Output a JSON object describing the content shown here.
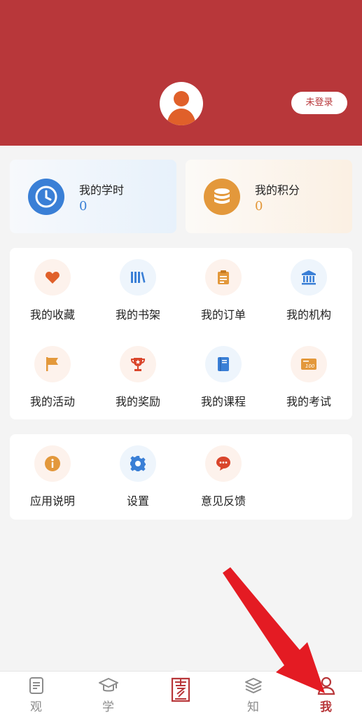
{
  "header": {
    "login_button": "未登录",
    "accent": "#b8373a"
  },
  "stats": [
    {
      "title": "我的学时",
      "value": "0",
      "icon": "clock-icon",
      "color": "#3a7fd6"
    },
    {
      "title": "我的积分",
      "value": "0",
      "icon": "coins-icon",
      "color": "#e3983b"
    }
  ],
  "menu": [
    {
      "label": "我的收藏",
      "icon": "heart-icon"
    },
    {
      "label": "我的书架",
      "icon": "bookshelf-icon"
    },
    {
      "label": "我的订单",
      "icon": "clipboard-icon"
    },
    {
      "label": "我的机构",
      "icon": "institution-icon"
    },
    {
      "label": "我的活动",
      "icon": "flag-icon"
    },
    {
      "label": "我的奖励",
      "icon": "trophy-icon"
    },
    {
      "label": "我的课程",
      "icon": "book-icon"
    },
    {
      "label": "我的考试",
      "icon": "exam-icon"
    }
  ],
  "menu2": [
    {
      "label": "应用说明",
      "icon": "info-icon"
    },
    {
      "label": "设置",
      "icon": "gear-icon"
    },
    {
      "label": "意见反馈",
      "icon": "chat-icon"
    }
  ],
  "tabs": [
    {
      "label": "观",
      "icon": "document-icon"
    },
    {
      "label": "学",
      "icon": "graduation-cap-icon"
    },
    {
      "label": "",
      "icon": "center-logo-icon"
    },
    {
      "label": "知",
      "icon": "books-icon"
    },
    {
      "label": "我",
      "icon": "user-icon",
      "active": true
    }
  ]
}
